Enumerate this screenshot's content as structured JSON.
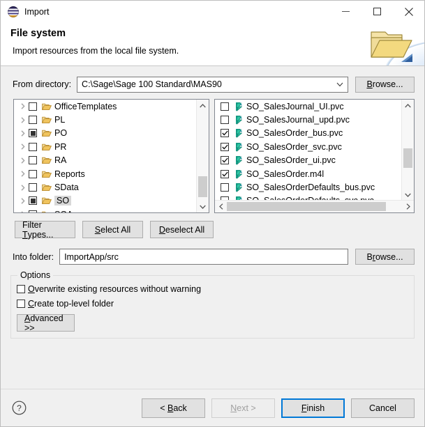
{
  "window": {
    "title": "Import",
    "icon": "eclipse-icon",
    "controls": {
      "minimize": "minimize-icon",
      "maximize": "maximize-icon",
      "close": "close-icon"
    }
  },
  "header": {
    "title": "File system",
    "subtitle": "Import resources from the local file system.",
    "banner_icon": "folder-icon"
  },
  "from_directory": {
    "label": "From directory:",
    "value": "C:\\Sage\\Sage 100 Standard\\MAS90",
    "placeholder": "",
    "browse_label": "Browse...",
    "chevron": "chevron-down-icon"
  },
  "tree": {
    "rows": [
      {
        "label": "OfficeTemplates",
        "state": "unchecked",
        "selected": false
      },
      {
        "label": "PL",
        "state": "unchecked",
        "selected": false
      },
      {
        "label": "PO",
        "state": "partial",
        "selected": false
      },
      {
        "label": "PR",
        "state": "unchecked",
        "selected": false
      },
      {
        "label": "RA",
        "state": "unchecked",
        "selected": false
      },
      {
        "label": "Reports",
        "state": "unchecked",
        "selected": false
      },
      {
        "label": "SData",
        "state": "unchecked",
        "selected": false
      },
      {
        "label": "SO",
        "state": "partial",
        "selected": true
      },
      {
        "label": "SOA",
        "state": "unchecked",
        "selected": false
      },
      {
        "label": "",
        "state": "unchecked",
        "selected": false
      }
    ]
  },
  "files": {
    "rows": [
      {
        "label": "SO_SalesJournal_UI.pvc",
        "state": "unchecked"
      },
      {
        "label": "SO_SalesJournal_upd.pvc",
        "state": "unchecked"
      },
      {
        "label": "SO_SalesOrder_bus.pvc",
        "state": "checked"
      },
      {
        "label": "SO_SalesOrder_svc.pvc",
        "state": "checked"
      },
      {
        "label": "SO_SalesOrder_ui.pvc",
        "state": "checked"
      },
      {
        "label": "SO_SalesOrder.m4l",
        "state": "checked"
      },
      {
        "label": "SO_SalesOrderDefaults_bus.pvc",
        "state": "unchecked"
      },
      {
        "label": "SO_SalesOrderDefaults_svc.pvc",
        "state": "unchecked"
      }
    ]
  },
  "mid_buttons": {
    "filter_types": "Filter Types...",
    "select_all": "Select All",
    "deselect_all": "Deselect All"
  },
  "into_folder": {
    "label": "Into folder:",
    "value": "ImportApp/src",
    "browse_label": "Browse..."
  },
  "options": {
    "legend": "Options",
    "overwrite": {
      "label": "Overwrite existing resources without warning",
      "checked": false
    },
    "create_top_level": {
      "label": "Create top-level folder",
      "checked": false
    },
    "advanced": "Advanced >>"
  },
  "footer": {
    "help": "help-icon",
    "back": "< Back",
    "next": "Next >",
    "next_disabled": true,
    "finish": "Finish",
    "cancel": "Cancel"
  },
  "colors": {
    "accent": "#0078d7",
    "folder": "#e8b84b",
    "file_icon": "#19a08a",
    "dialog_bg": "#f0f0f0"
  }
}
